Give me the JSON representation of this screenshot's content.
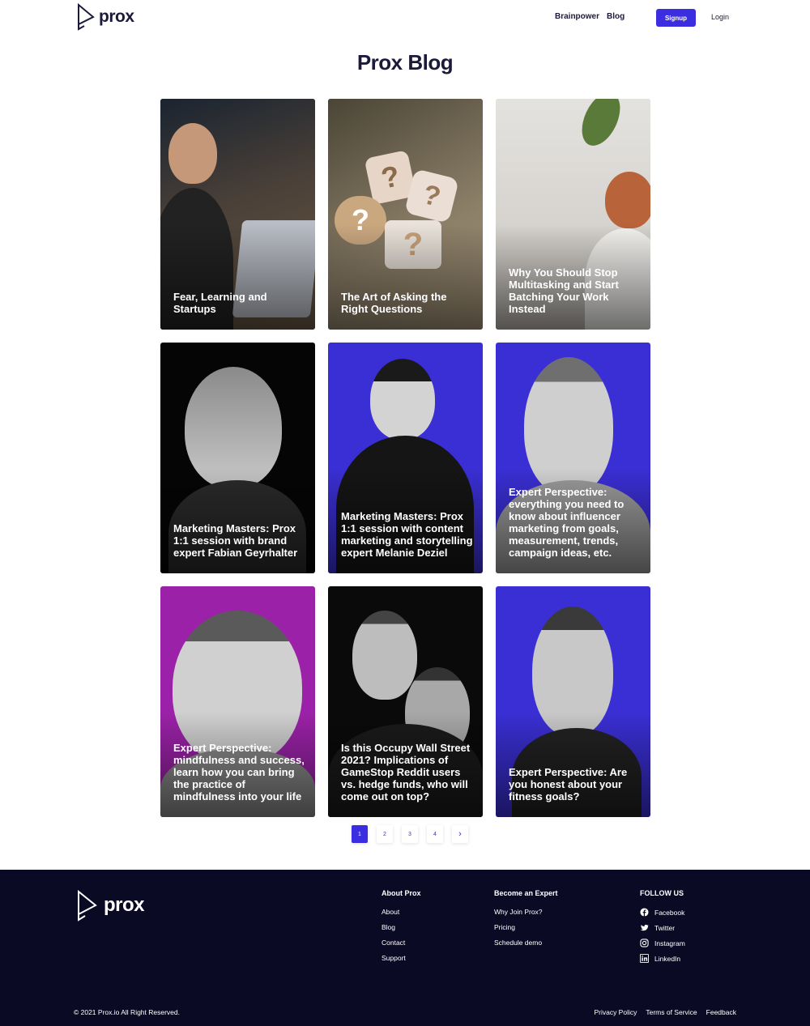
{
  "brand": {
    "name": "prox"
  },
  "nav": {
    "brainpower": "Brainpower",
    "blog": "Blog",
    "signup": "Signup",
    "login": "Login"
  },
  "page": {
    "title": "Prox Blog"
  },
  "posts": [
    {
      "title": "Fear, Learning and Startups",
      "bg": "#3a3a3a"
    },
    {
      "title": "The Art of Asking the Right Questions",
      "bg": "#8a7e6e"
    },
    {
      "title": "Why You Should Stop Multitasking and Start Batching Your Work Instead",
      "bg": "#d9d6d2"
    },
    {
      "title": "Marketing Masters: Prox 1:1 session with brand expert Fabian Geyrhalter",
      "bg": "#050505"
    },
    {
      "title": "Marketing Masters: Prox 1:1 session with content marketing and storytelling expert Melanie Deziel",
      "bg": "#3a2fd4"
    },
    {
      "title": "Expert Perspective: everything you need to know about influencer marketing from goals, measurement, trends, campaign ideas, etc.",
      "bg": "#3a2fd4"
    },
    {
      "title": "Expert Perspective: mindfulness and success, learn how you can bring the practice of mindfulness into your life",
      "bg": "#9b22a8"
    },
    {
      "title": "Is this Occupy Wall Street 2021? Implications of GameStop Reddit users vs. hedge funds, who will come out on top?",
      "bg": "#0a0a0a"
    },
    {
      "title": "Expert Perspective: Are you honest about your fitness goals?",
      "bg": "#3a2fd4"
    }
  ],
  "pagination": {
    "pages": [
      "1",
      "2",
      "3",
      "4"
    ],
    "current": "1",
    "next": "›"
  },
  "footer": {
    "about": {
      "heading": "About Prox",
      "links": [
        "About",
        "Blog",
        "Contact",
        "Support"
      ]
    },
    "expert": {
      "heading": "Become an Expert",
      "links": [
        "Why Join Prox?",
        "Pricing",
        "Schedule demo"
      ]
    },
    "follow": {
      "heading": "FOLLOW US",
      "links": [
        {
          "label": "Facebook",
          "icon": "facebook-icon"
        },
        {
          "label": "Twitter",
          "icon": "twitter-icon"
        },
        {
          "label": "Instagram",
          "icon": "instagram-icon"
        },
        {
          "label": "LinkedIn",
          "icon": "linkedin-icon"
        }
      ]
    },
    "copyright": "© 2021 Prox.io All Right Reserved.",
    "legal": [
      "Privacy Policy",
      "Terms of Service",
      "Feedback"
    ]
  },
  "colors": {
    "accent": "#3a2ee0",
    "footer_bg": "#0b0a25",
    "title": "#1c1a3a"
  }
}
